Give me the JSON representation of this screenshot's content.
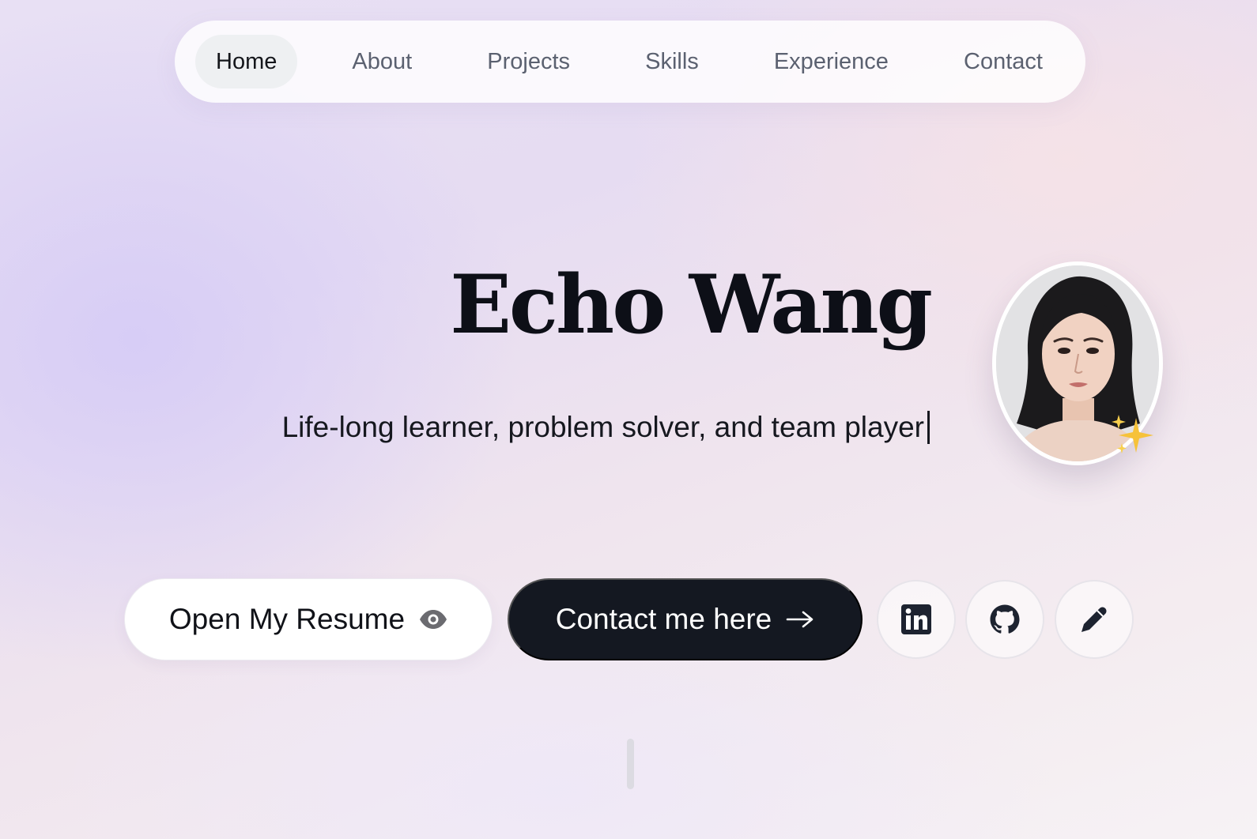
{
  "nav": {
    "items": [
      {
        "label": "Home",
        "active": true
      },
      {
        "label": "About",
        "active": false
      },
      {
        "label": "Projects",
        "active": false
      },
      {
        "label": "Skills",
        "active": false
      },
      {
        "label": "Experience",
        "active": false
      },
      {
        "label": "Contact",
        "active": false
      }
    ]
  },
  "hero": {
    "name": "Echo Wang",
    "tagline": "Life-long learner, problem solver, and team player",
    "avatar_icon": "profile-photo",
    "sparkle_icon": "sparkles-icon"
  },
  "actions": {
    "resume_label": "Open My Resume",
    "resume_icon": "eye-icon",
    "contact_label": "Contact me here",
    "contact_icon": "arrow-right-icon",
    "social": [
      {
        "icon": "linkedin-icon"
      },
      {
        "icon": "github-icon"
      },
      {
        "icon": "pencil-icon"
      }
    ]
  },
  "colors": {
    "primary_dark": "#141821",
    "text": "#0d0f17",
    "nav_text": "#5b6170",
    "nav_active_bg": "#eef0f2"
  }
}
